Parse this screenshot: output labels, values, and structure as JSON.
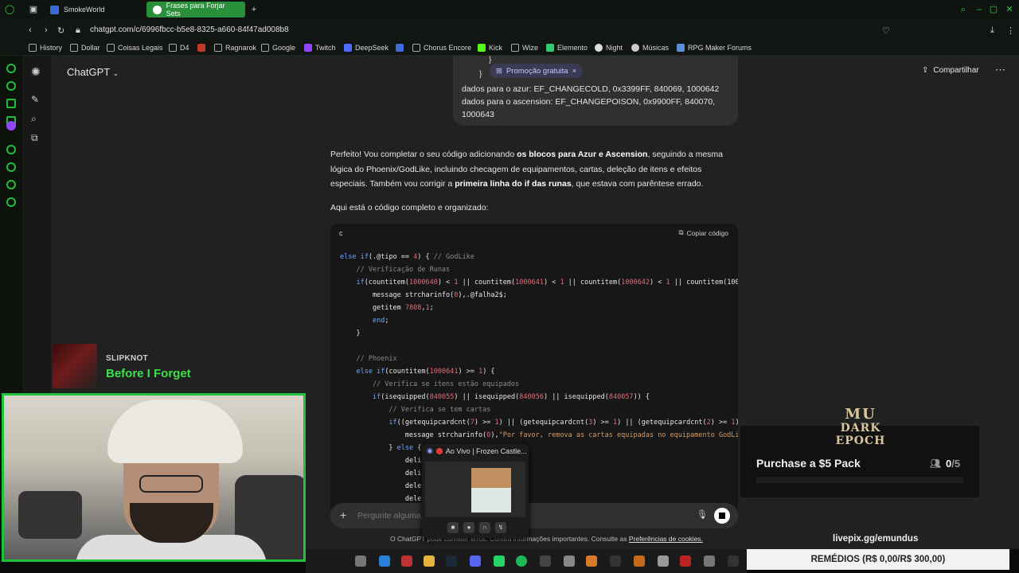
{
  "browser": {
    "tabs": [
      {
        "label": "SmokeWorld",
        "active": false
      },
      {
        "label": "Frases para Forjar Sets",
        "active": true
      }
    ],
    "url": "chatgpt.com/c/6996fbcc-b5e8-8325-a660-84f47ad008b8",
    "bookmarks": [
      "History",
      "Dollar",
      "Coisas Legais",
      "D4",
      "Ragnarok",
      "Google",
      "Twitch",
      "DeepSeek",
      "Chorus Encore",
      "Kick",
      "Wize",
      "Elemento",
      "Night",
      "Músicas",
      "RPG Maker Forums"
    ],
    "accent": "#1fc23a"
  },
  "chatgpt": {
    "title": "ChatGPT",
    "share_label": "Compartilhar",
    "promo_label": "Promoção gratuita",
    "user_message": {
      "brace_a": "}",
      "brace_b": "}",
      "line1": "dados para o azur: EF_CHANGECOLD, 0x3399FF, 840069, 1000642",
      "line2": "dados para o ascension: EF_CHANGEPOISON, 0x9900FF, 840070,",
      "line3": "1000643"
    },
    "response": {
      "p1_a": "Perfeito! Vou completar o seu código adicionando ",
      "p1_b": "os blocos para Azur e Ascension",
      "p1_c": ", seguindo a mesma lógica do Phoenix/GodLike, incluindo checagem de equipamentos, cartas, deleção de itens e efeitos especiais. Também vou corrigir a ",
      "p1_d": "primeira linha do if das runas",
      "p1_e": ", que estava com parêntese errado.",
      "p2": "Aqui está o código completo e organizado:"
    },
    "code": {
      "language": "c",
      "copy_label": "Copiar código",
      "lines": [
        "else if(.@tipo == 4) { // GodLike",
        "    // Verificação de Runas",
        "    if(countitem(1000640) < 1 || countitem(1000641) < 1 || countitem(1000642) < 1 || countitem(100",
        "        message strcharinfo(0),.@falha2$;",
        "        getitem 7808,1;",
        "        end;",
        "    }",
        "",
        "    // Phoenix",
        "    else if(countitem(1000641) >= 1) {",
        "        // Verifica se itens estão equipados",
        "        if(isequipped(840055) || isequipped(840056) || isequipped(840057)) {",
        "            // Verifica se tem cartas",
        "            if((getequipcardcnt(7) >= 1) || (getequipcardcnt(3) >= 1) || (getequipcardcnt(2) >= 1)",
        "                message strcharinfo(0),\"Por favor, remova as cartas equipadas no equipamento GodLi",
        "            } else {",
        "                deli",
        "                deli",
        "                dele",
        "                dele"
      ]
    },
    "composer_placeholder": "Pergunte alguma",
    "footer_a": "O ChatGPT pode cometer erros. Confira informações importantes. Consulte as ",
    "footer_link": "Preferências de cookies."
  },
  "stream": {
    "music_artist": "SLIPKNOT",
    "music_song": "Before I Forget",
    "popup_title": "Ao Vivo | Frozen Castle...",
    "ad_logo_1": "MU",
    "ad_logo_2": "DARK EPOCH",
    "ad_title": "Purchase a $5 Pack",
    "ad_count": "0",
    "ad_total": "/5",
    "livepix": "livepix.gg/emundus",
    "remedios": "REMÉDIOS (R$ 0,00/R$ 300,00)"
  }
}
